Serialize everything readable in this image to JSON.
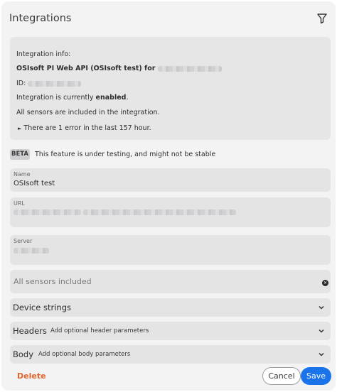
{
  "header": {
    "title": "Integrations",
    "filter_icon": "filter-icon"
  },
  "info": {
    "heading": "Integration info:",
    "name_line": "OSIsoft PI Web API (OSIsoft test) for",
    "id_label": "ID:",
    "status_prefix": "Integration is currently",
    "status_value": "enabled",
    "status_suffix": ".",
    "sensors_line": "All sensors are included in the integration.",
    "errors_line": "There are 1 error in the last 157 hour."
  },
  "beta": {
    "badge": "BETA",
    "text": "This feature is under testing, and might not be stable"
  },
  "form": {
    "name": {
      "label": "Name",
      "value": "OSIsoft test"
    },
    "url": {
      "label": "URL"
    },
    "server": {
      "label": "Server"
    },
    "sensors": {
      "placeholder": "All sensors included"
    }
  },
  "accordions": {
    "device_strings": {
      "title": "Device strings"
    },
    "headers": {
      "title": "Headers",
      "subtitle": "Add optional header parameters"
    },
    "body": {
      "title": "Body",
      "subtitle": "Add optional body parameters"
    }
  },
  "actions": {
    "delete": "Delete",
    "cancel": "Cancel",
    "save": "Save"
  },
  "colors": {
    "accent": "#1a73e8",
    "danger": "#e0642d",
    "panel": "#f3f3f4"
  }
}
